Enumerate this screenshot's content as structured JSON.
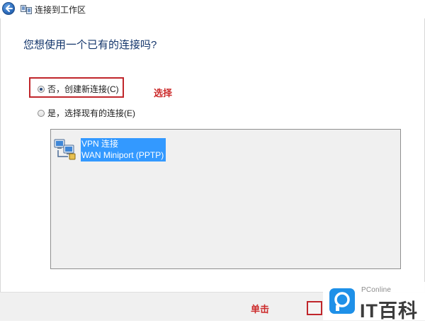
{
  "window": {
    "title": "连接到工作区"
  },
  "question": "您想使用一个已有的连接吗?",
  "options": [
    {
      "label": "否，创建新连接(C)",
      "checked": true
    },
    {
      "label": "是，选择现有的连接(E)",
      "checked": false
    }
  ],
  "annotations": {
    "select": "选择",
    "click": "单击"
  },
  "connections": [
    {
      "name": "VPN 连接",
      "device": "WAN Miniport (PPTP)",
      "icon": "vpn-connection-icon",
      "selected": true
    }
  ],
  "watermark": {
    "brand": "PConline",
    "logo_text": "IT百科"
  },
  "colors": {
    "annotation": "#cc2a2a",
    "selection": "#3399ff",
    "question": "#13356b"
  }
}
